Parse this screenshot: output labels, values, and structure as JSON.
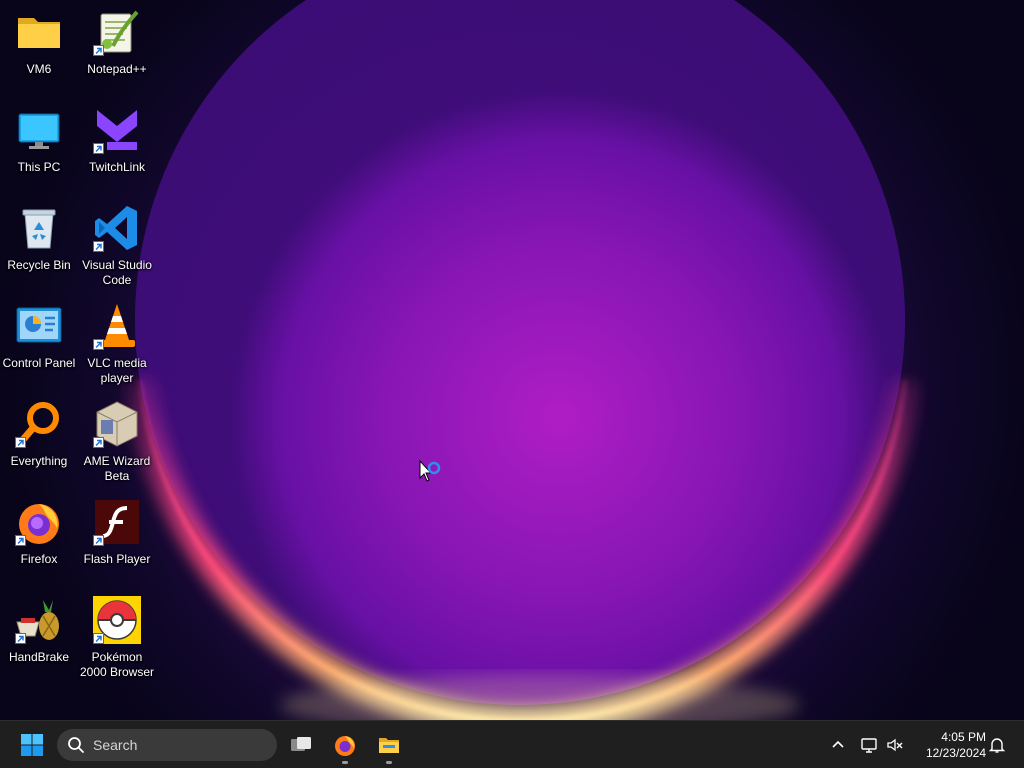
{
  "desktop": {
    "icons": [
      {
        "label": "VM6",
        "name": "desktop-icon-vm6",
        "icon": "folder-icon",
        "shortcut": false
      },
      {
        "label": "Notepad++",
        "name": "desktop-icon-notepadpp",
        "icon": "notepadpp-icon",
        "shortcut": true
      },
      {
        "label": "This PC",
        "name": "desktop-icon-this-pc",
        "icon": "monitor-icon",
        "shortcut": false
      },
      {
        "label": "TwitchLink",
        "name": "desktop-icon-twitchlink",
        "icon": "twitchlink-icon",
        "shortcut": true
      },
      {
        "label": "Recycle Bin",
        "name": "desktop-icon-recycle-bin",
        "icon": "recycle-bin-icon",
        "shortcut": false
      },
      {
        "label": "Visual Studio\nCode",
        "name": "desktop-icon-vscode",
        "icon": "vscode-icon",
        "shortcut": true
      },
      {
        "label": "Control Panel",
        "name": "desktop-icon-control-panel",
        "icon": "control-panel-icon",
        "shortcut": false
      },
      {
        "label": "VLC media\nplayer",
        "name": "desktop-icon-vlc",
        "icon": "vlc-icon",
        "shortcut": true
      },
      {
        "label": "Everything",
        "name": "desktop-icon-everything",
        "icon": "magnifier-icon",
        "shortcut": true
      },
      {
        "label": "AME Wizard\nBeta",
        "name": "desktop-icon-ame-wizard",
        "icon": "ame-wizard-icon",
        "shortcut": true
      },
      {
        "label": "Firefox",
        "name": "desktop-icon-firefox",
        "icon": "firefox-icon",
        "shortcut": true
      },
      {
        "label": "Flash Player",
        "name": "desktop-icon-flash-player",
        "icon": "flash-icon",
        "shortcut": true
      },
      {
        "label": "HandBrake",
        "name": "desktop-icon-handbrake",
        "icon": "handbrake-icon",
        "shortcut": true
      },
      {
        "label": "Pokémon\n2000 Browser",
        "name": "desktop-icon-pokemon-browser",
        "icon": "pokeball-icon",
        "shortcut": true
      }
    ]
  },
  "taskbar": {
    "search_placeholder": "Search",
    "pinned": [
      "windows-start-icon",
      "task-view-icon",
      "firefox-icon",
      "file-explorer-icon"
    ],
    "tray": [
      "chevron-up-icon",
      "network-icon",
      "volume-muted-icon",
      "notification-bell-icon"
    ],
    "clock": {
      "time": "4:05 PM",
      "date": "12/23/2024"
    }
  },
  "colors": {
    "taskbar_bg": "#1f1f1f",
    "search_bg": "#3a3a3a",
    "accent_blue": "#2f8ff0",
    "wallpaper_glow": "#b01fd0"
  }
}
